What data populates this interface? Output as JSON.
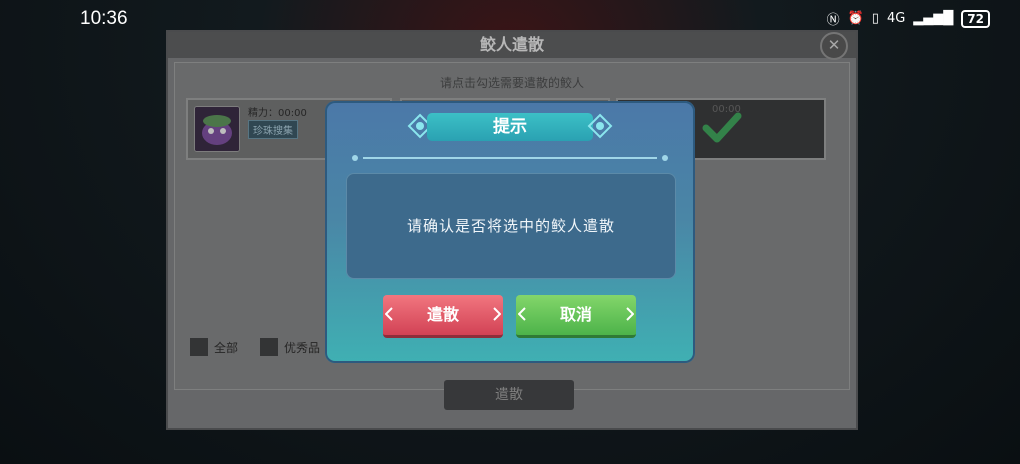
{
  "status_bar": {
    "time": "10:36",
    "network": "4G",
    "battery": "72"
  },
  "panel": {
    "title": "鲛人遣散",
    "close_icon": "close-icon",
    "hint": "请点击勾选需要遣散的鲛人",
    "cards": [
      {
        "label": "精力：00:00",
        "tag": "珍珠搜集",
        "selected": false
      },
      {
        "label": "",
        "tag": "",
        "selected": false
      },
      {
        "label": "00:00",
        "tag": "",
        "selected": true
      }
    ],
    "filters": [
      {
        "label": "全部"
      },
      {
        "label": "优秀品"
      }
    ],
    "dismiss_button": "遣散"
  },
  "dialog": {
    "title": "提示",
    "message": "请确认是否将选中的鲛人遣散",
    "confirm_button": "遣散",
    "cancel_button": "取消",
    "colors": {
      "confirm": "#e25566",
      "cancel": "#5fc352"
    }
  }
}
